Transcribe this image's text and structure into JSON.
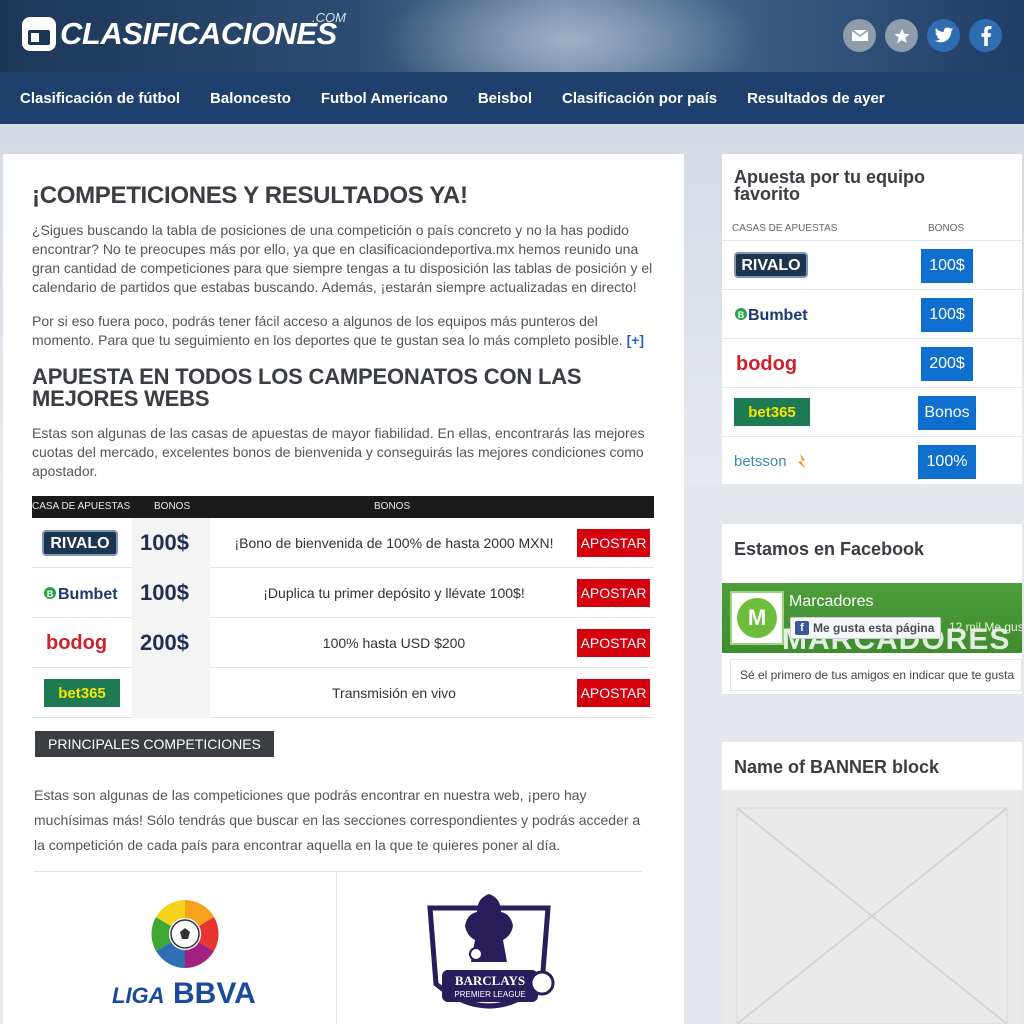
{
  "header": {
    "logo_text": "CLASIFICACIONES",
    "logo_suffix": ".COM",
    "social": [
      "mail-icon",
      "star-icon",
      "twitter-icon",
      "facebook-icon"
    ]
  },
  "nav": {
    "items": [
      "Clasificación de fútbol",
      "Baloncesto",
      "Futbol Americano",
      "Beisbol",
      "Clasificación por país",
      "Resultados de ayer"
    ]
  },
  "main": {
    "title": "¡COMPETICIONES Y RESULTADOS YA!",
    "intro": "¿Sigues buscando la tabla de posiciones de una competición o país concreto y no la has podido encontrar? No te preocupes más por ello, ya que en clasificaciondeportiva.mx hemos reunido una gran cantidad de competiciones para que siempre tengas a tu disposición las tablas de posición y el calendario de partidos que estabas buscando. Además, ¡estarán siempre actualizadas en directo!",
    "intro2": "Por si eso fuera poco, podrás tener fácil acceso a algunos de los equipos más punteros del momento. Para que tu seguimiento en los deportes que te gustan sea lo más completo posible.",
    "more_link": "[+]",
    "subtitle": "APUESTA EN TODOS LOS CAMPEONATOS CON LAS MEJORES WEBS",
    "subtitle_text": "Estas son algunas de las casas de apuestas de mayor fiabilidad. En ellas, encontrarás las mejores cuotas del mercado, excelentes bonos de bienvenida y conseguirás las mejores condiciones como apostador.",
    "table": {
      "headers": [
        "CASA DE APUESTAS",
        "BONOS",
        "BONOS"
      ],
      "rows": [
        {
          "brand": "RIVALO",
          "amount": "100$",
          "desc": "¡Bono de bienvenida de 100% de hasta 2000 MXN!",
          "button": "APOSTAR"
        },
        {
          "brand": "Bumbet",
          "amount": "100$",
          "desc": "¡Duplica tu primer depósito y llévate 100$!",
          "button": "APOSTAR"
        },
        {
          "brand": "bodog",
          "amount": "200$",
          "desc": "100% hasta USD $200",
          "button": "APOSTAR"
        },
        {
          "brand": "bet365",
          "amount": "",
          "desc": "Transmisión en vivo",
          "button": "APOSTAR"
        }
      ]
    },
    "section_label": "PRINCIPALES COMPETICIONES",
    "section_text": "Estas son algunas de las competiciones que podrás encontrar en nuestra web, ¡pero hay muchísimas más! Sólo tendrás que buscar en las secciones correspondientes y podrás acceder a la competición de cada país para encontrar aquella en la que te quieres poner al día.",
    "competitions": [
      {
        "name_prefix": "LIGA",
        "name_suffix": "BBVA"
      },
      {
        "line1": "BARCLAYS",
        "line2": "PREMIER LEAGUE"
      }
    ]
  },
  "sidebar": {
    "bets_title": "Apuesta por tu equipo favorito",
    "col_houses": "CASAS DE APUESTAS",
    "col_bonus": "BONOS",
    "bets": [
      {
        "brand": "RIVALO",
        "bonus": "100$"
      },
      {
        "brand": "Bumbet",
        "bonus": "100$"
      },
      {
        "brand": "bodog",
        "bonus": "200$"
      },
      {
        "brand": "bet365",
        "bonus": "Bonos"
      },
      {
        "brand": "betsson",
        "bonus": "100%"
      }
    ],
    "facebook_title": "Estamos en Facebook",
    "fb_page_name": "Marcadores",
    "fb_banner_word": "MARCADORES",
    "fb_like": "Me gusta esta página",
    "fb_count": "12 mil Me gus",
    "fb_friends": "Sé el primero de tus amigos en indicar que te gusta",
    "banner_title": "Name of BANNER block"
  }
}
